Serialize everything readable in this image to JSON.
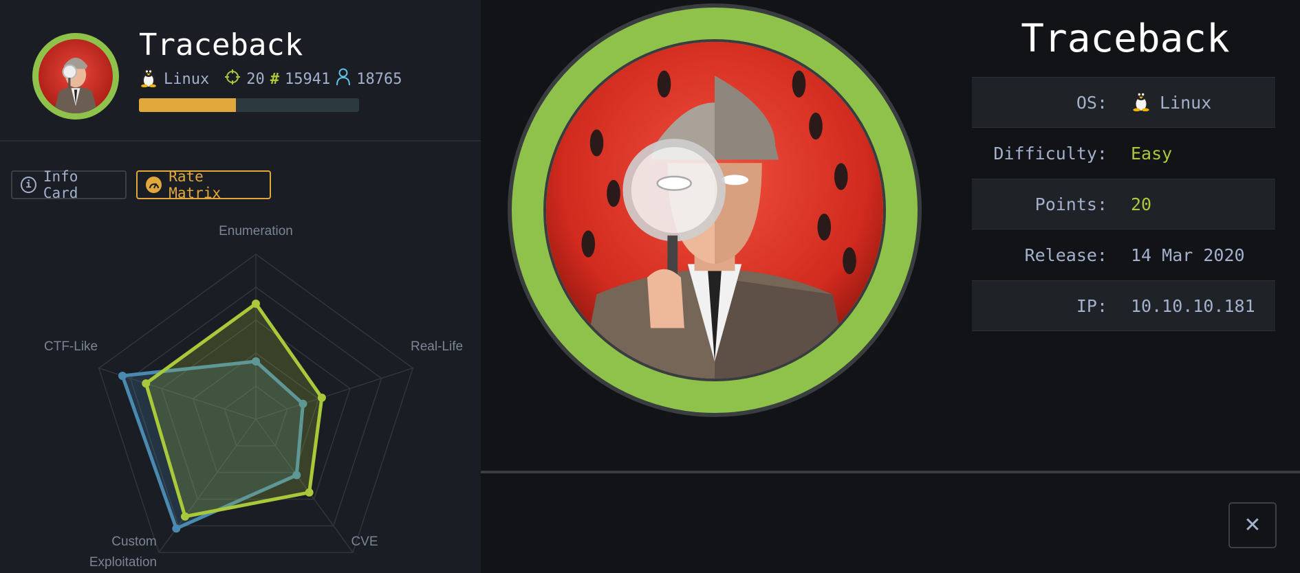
{
  "machine": {
    "name": "Traceback",
    "os": "Linux",
    "points": "20",
    "rank": "15941",
    "users": "18765",
    "progress_percent": 44
  },
  "buttons": {
    "info_card": "Info Card",
    "rate_matrix": "Rate Matrix"
  },
  "chart_data": {
    "type": "radar",
    "categories": [
      "Enumeration",
      "Real-Life",
      "CVE",
      "Custom Exploitation",
      "CTF-Like"
    ],
    "label_lines": [
      [
        "Enumeration"
      ],
      [
        "Real-Life"
      ],
      [
        "CVE"
      ],
      [
        "Custom",
        "Exploitation"
      ],
      [
        "CTF-Like"
      ]
    ],
    "max": 10,
    "series": [
      {
        "color": "#4a8ab0",
        "values": [
          3.5,
          3.0,
          4.2,
          8.2,
          8.5
        ]
      },
      {
        "color": "#a9c93a",
        "values": [
          7.0,
          4.2,
          5.5,
          7.3,
          7.0
        ]
      }
    ]
  },
  "info": {
    "title": "Traceback",
    "rows": [
      {
        "key": "OS:",
        "value": "Linux",
        "icon": "tux-icon"
      },
      {
        "key": "Difficulty:",
        "value": "Easy",
        "color": "#a9c93a"
      },
      {
        "key": "Points:",
        "value": "20",
        "color": "#a9c93a"
      },
      {
        "key": "Release:",
        "value": "14 Mar 2020"
      },
      {
        "key": "IP:",
        "value": "10.10.10.181"
      }
    ]
  },
  "close_label": "✕"
}
